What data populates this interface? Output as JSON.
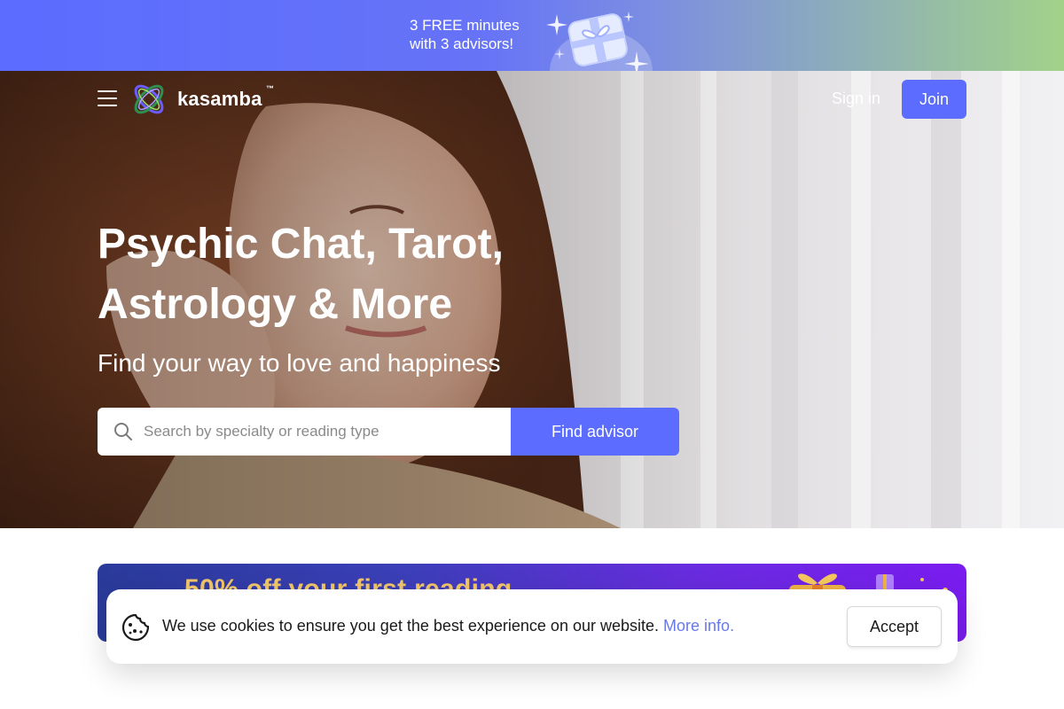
{
  "promo": {
    "line1": "3 FREE minutes",
    "line2": "with 3 advisors!",
    "icon": "gift-icon"
  },
  "nav": {
    "menu_icon": "hamburger-menu-icon",
    "logo_text": "kasamba",
    "logo_tm": "™",
    "sign_in": "Sign in",
    "join": "Join"
  },
  "hero": {
    "title_line1": "Psychic Chat, Tarot,",
    "title_line2": "Astrology & More",
    "subtitle": "Find your way to love and happiness",
    "search": {
      "placeholder": "Search by specialty or reading type",
      "value": "",
      "icon": "search-icon",
      "button": "Find advisor"
    }
  },
  "offer": {
    "text": "50% off your first reading"
  },
  "cookie": {
    "icon": "cookie-icon",
    "message": "We use cookies to ensure you get the best experience on our website.",
    "link": "More info.",
    "accept": "Accept"
  },
  "colors": {
    "accent": "#5b6cff",
    "link": "#6a78e8",
    "offer_text": "#f2c66b"
  }
}
